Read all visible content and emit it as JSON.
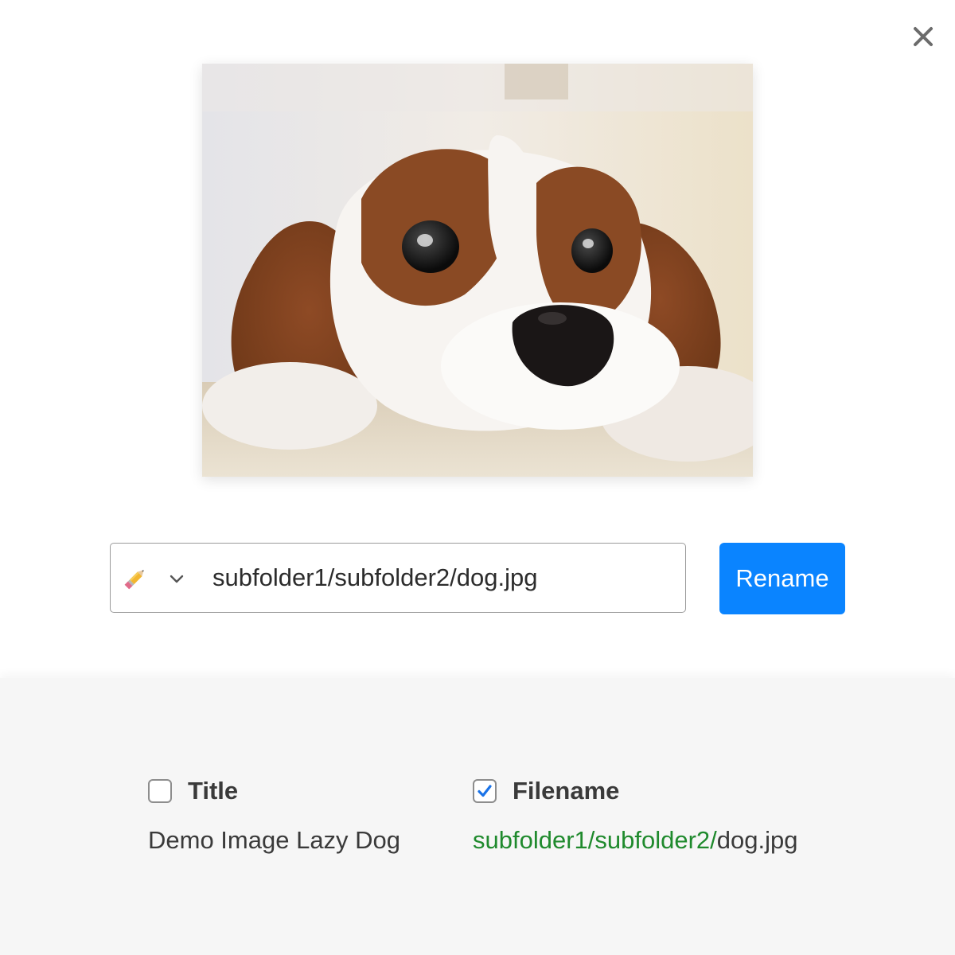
{
  "dialog": {
    "close_icon": "close-icon",
    "image": {
      "alt": "Cavalier King Charles Spaniel puppy resting its head on a carpet"
    },
    "rename_field": {
      "mode_icon": "pencil-icon",
      "dropdown_icon": "chevron-down-icon",
      "value": "subfolder1/subfolder2/dog.jpg"
    },
    "rename_button": {
      "label": "Rename",
      "color": "#0a84ff"
    }
  },
  "details": {
    "title": {
      "checked": false,
      "label": "Title",
      "value": "Demo Image Lazy Dog"
    },
    "filename": {
      "checked": true,
      "label": "Filename",
      "value_prefix": "subfolder1/subfolder2/",
      "value_name": "dog.jpg",
      "prefix_color": "#1f8a2d"
    }
  },
  "colors": {
    "accent": "#0a84ff",
    "check": "#1a73e8",
    "panel_bg": "#f6f6f6"
  }
}
